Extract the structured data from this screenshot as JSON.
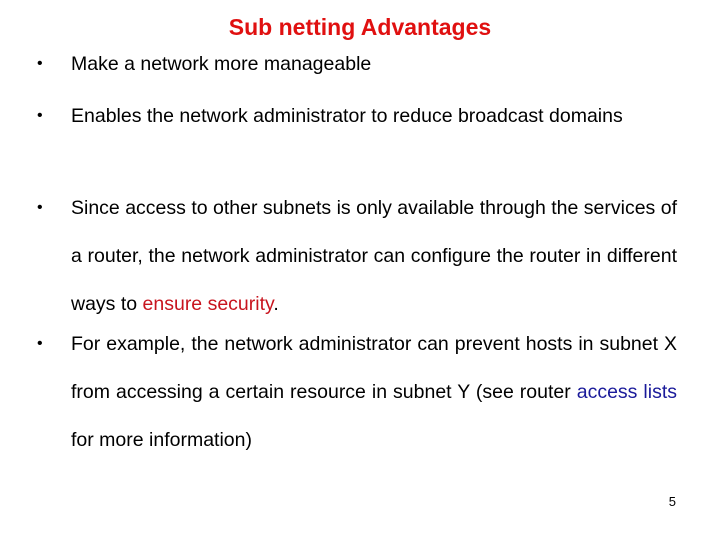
{
  "slide": {
    "title": "Sub netting Advantages",
    "bullet_glyph": "•",
    "bullets": [
      {
        "text": "Make a network more manageable"
      },
      {
        "text": "Enables the network administrator to reduce broadcast domains"
      },
      {
        "before": "Since access to other subnets is only available through the services of a router, the network administrator can configure the router in different ways to ",
        "highlight": "ensure security",
        "after": "."
      },
      {
        "before": " For example, the network administrator can prevent hosts in subnet X from accessing a certain resource in subnet Y (see router ",
        "highlight": "access lists",
        "after": " for more information)"
      }
    ],
    "colors": {
      "title": "#e01010",
      "security_highlight": "#c8141e",
      "link_highlight": "#1a1a9a"
    },
    "page_number": "5"
  }
}
